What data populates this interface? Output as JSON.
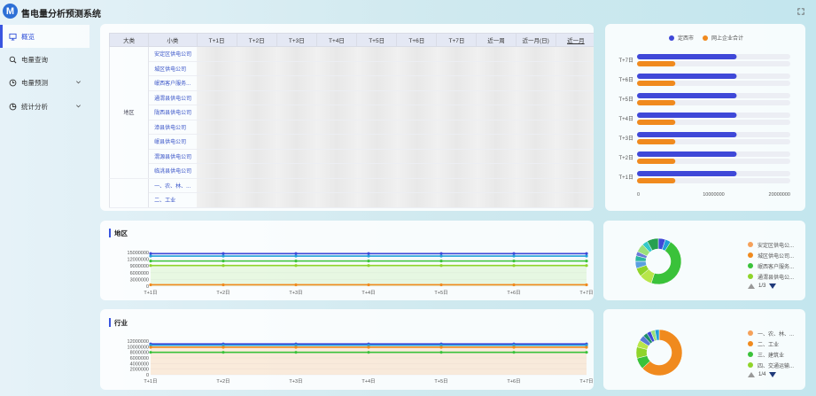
{
  "app": {
    "title": "售电量分析预测系统",
    "logo_letter": "M"
  },
  "sidebar": {
    "items": [
      {
        "label": "概览",
        "icon": "monitor-icon"
      },
      {
        "label": "电量查询",
        "icon": "search-icon"
      },
      {
        "label": "电量预测",
        "icon": "forecast-icon"
      },
      {
        "label": "统计分析",
        "icon": "pie-chart-icon"
      }
    ]
  },
  "table": {
    "headers": [
      "大类",
      "小类",
      "T+1日",
      "T+2日",
      "T+3日",
      "T+4日",
      "T+5日",
      "T+6日",
      "T+7日",
      "近一周",
      "近一月(日)",
      "近一月"
    ],
    "group_label": "地区",
    "rows": [
      "安定区供电公司",
      "城区供电公司",
      "岷西客户服务...",
      "通渭县供电公司",
      "陇西县供电公司",
      "漳县供电公司",
      "岷县供电公司",
      "渭源县供电公司",
      "临洮县供电公司",
      "一、农、林、...",
      "二、工业"
    ]
  },
  "bar_chart": {
    "legend": [
      "定西市",
      "网上企业合计"
    ],
    "colors": [
      "#3f48d8",
      "#f08a1e"
    ],
    "categories": [
      "T+1日",
      "T+2日",
      "T+3日",
      "T+4日",
      "T+5日",
      "T+6日",
      "T+7日"
    ],
    "xticks": [
      "0",
      "10000000",
      "20000000"
    ]
  },
  "region": {
    "title": "地区",
    "yticks": [
      "15000000",
      "12000000",
      "9000000",
      "6000000",
      "3000000",
      "0"
    ],
    "xticks": [
      "T+1日",
      "T+2日",
      "T+3日",
      "T+4日",
      "T+5日",
      "T+6日",
      "T+7日"
    ],
    "legend": [
      "安定区供电公...",
      "城区供电公司...",
      "岷西客户服务...",
      "通渭县供电公..."
    ],
    "pager": "1/3"
  },
  "industry": {
    "title": "行业",
    "yticks": [
      "12000000",
      "10000000",
      "8000000",
      "6000000",
      "4000000",
      "2000000",
      "0"
    ],
    "xticks": [
      "T+1日",
      "T+2日",
      "T+3日",
      "T+4日",
      "T+5日",
      "T+6日",
      "T+7日"
    ],
    "legend": [
      "一、农、林、...",
      "二、工业",
      "三、建筑业",
      "四、交通运输..."
    ],
    "pager": "1/4"
  },
  "chart_data": [
    {
      "type": "bar",
      "categories": [
        "T+7日",
        "T+6日",
        "T+5日",
        "T+4日",
        "T+3日",
        "T+2日",
        "T+1日"
      ],
      "series": [
        {
          "name": "定西市",
          "values": [
            13000000,
            13000000,
            13000000,
            13000000,
            13000000,
            13000000,
            13000000
          ]
        },
        {
          "name": "网上企业合计",
          "values": [
            5000000,
            5000000,
            5000000,
            5000000,
            5000000,
            5000000,
            5000000
          ]
        }
      ],
      "xlim": [
        0,
        20000000
      ]
    },
    {
      "type": "line",
      "title": "地区",
      "x": [
        "T+1日",
        "T+2日",
        "T+3日",
        "T+4日",
        "T+5日",
        "T+6日",
        "T+7日"
      ],
      "ylim": [
        0,
        15000000
      ],
      "series": [
        {
          "values": [
            14500000,
            14500000,
            14500000,
            14500000,
            14500000,
            14500000,
            14500000
          ],
          "color": "#3f48d8"
        },
        {
          "values": [
            13400000,
            13400000,
            13400000,
            13400000,
            13400000,
            13400000,
            13400000
          ],
          "color": "#22a0d8"
        },
        {
          "values": [
            11200000,
            11200000,
            11200000,
            11200000,
            11200000,
            11200000,
            11200000
          ],
          "color": "#3ac23a"
        },
        {
          "values": [
            9200000,
            9200000,
            9200000,
            9200000,
            9200000,
            9200000,
            9200000
          ],
          "color": "#8fd42a"
        },
        {
          "values": [
            600000,
            600000,
            600000,
            600000,
            600000,
            600000,
            600000
          ],
          "color": "#f08a1e"
        }
      ]
    },
    {
      "type": "line",
      "title": "行业",
      "x": [
        "T+1日",
        "T+2日",
        "T+3日",
        "T+4日",
        "T+5日",
        "T+6日",
        "T+7日"
      ],
      "ylim": [
        0,
        12000000
      ],
      "series": [
        {
          "values": [
            11000000,
            11000000,
            11000000,
            11000000,
            11000000,
            11000000,
            11000000
          ],
          "color": "#3f48d8"
        },
        {
          "values": [
            10500000,
            10500000,
            10500000,
            10500000,
            10500000,
            10500000,
            10500000
          ],
          "color": "#22a0d8"
        },
        {
          "values": [
            9800000,
            9800000,
            9800000,
            9800000,
            9800000,
            9800000,
            9800000
          ],
          "color": "#f08a1e"
        },
        {
          "values": [
            8000000,
            8000000,
            8000000,
            8000000,
            8000000,
            8000000,
            8000000
          ],
          "color": "#3ac23a"
        }
      ]
    },
    {
      "type": "pie",
      "title": "地区",
      "values": [
        5,
        4,
        46,
        9,
        6,
        5,
        4,
        3,
        6,
        4,
        8
      ],
      "colors": [
        "#3f48d8",
        "#22a0d8",
        "#3ac23a",
        "#b8e64a",
        "#8fd42a",
        "#5aa0e0",
        "#2bb7a0",
        "#6a7ad8",
        "#9be07a",
        "#34c9c9",
        "#26a050"
      ]
    },
    {
      "type": "pie",
      "title": "行业",
      "values": [
        63,
        8,
        8,
        5,
        4,
        3,
        3,
        3,
        3
      ],
      "colors": [
        "#f08a1e",
        "#3ac23a",
        "#8fd42a",
        "#b8e64a",
        "#5a7ad8",
        "#1f8f6a",
        "#3f48d8",
        "#9be07a",
        "#22a0d8"
      ]
    }
  ]
}
